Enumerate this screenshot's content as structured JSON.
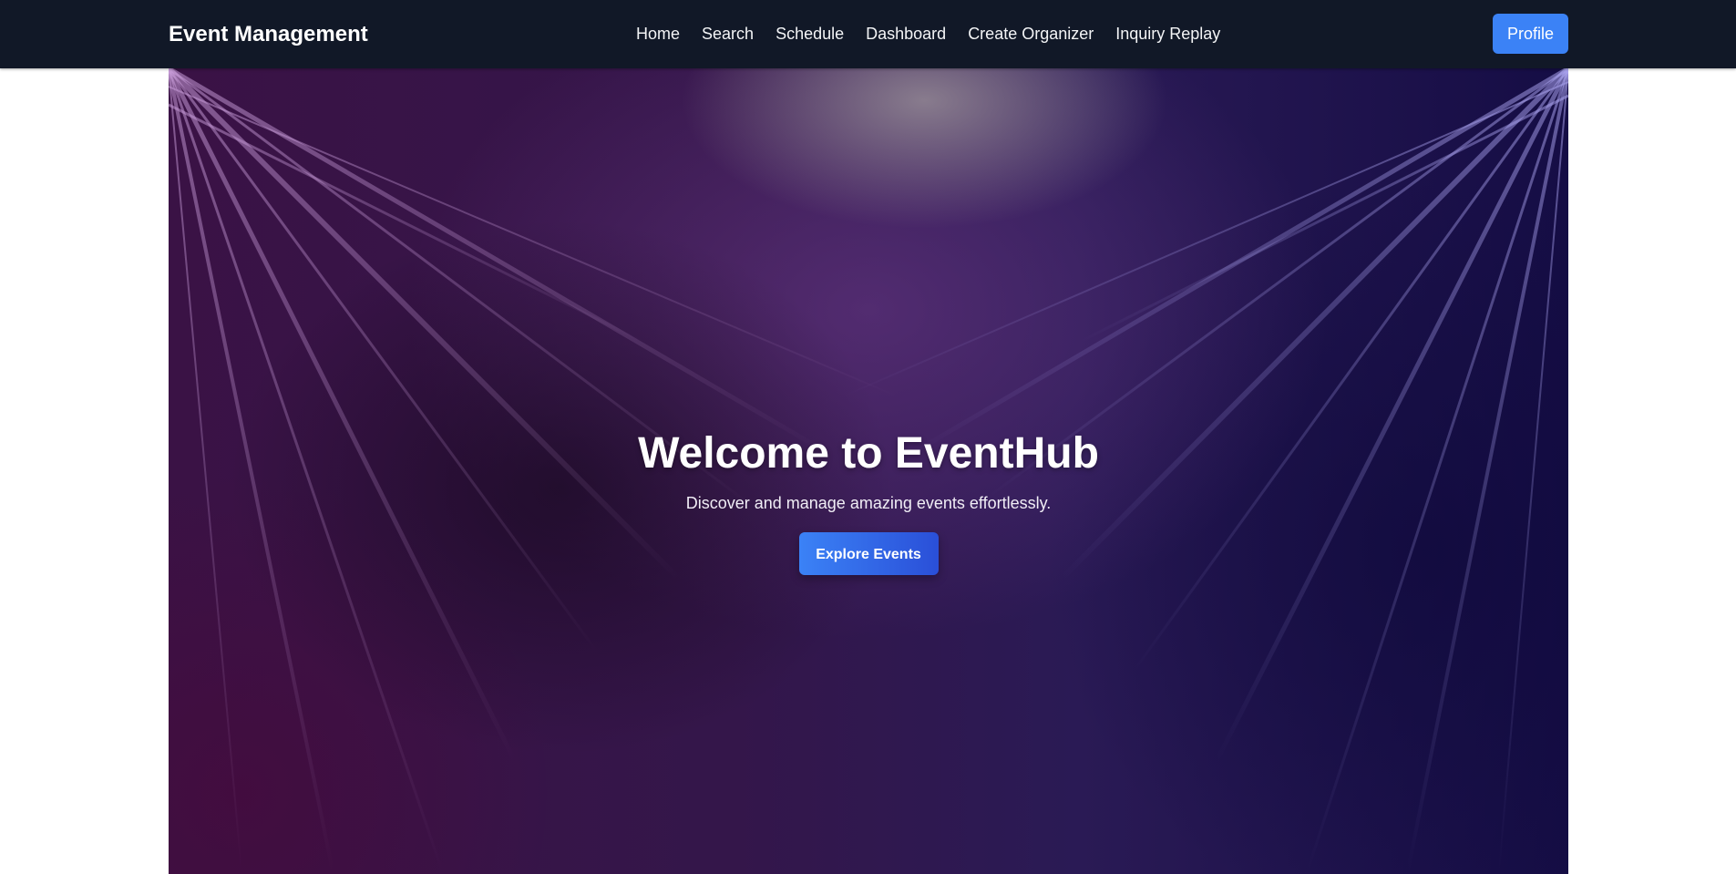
{
  "navbar": {
    "brand": "Event Management",
    "links": [
      {
        "label": "Home"
      },
      {
        "label": "Search"
      },
      {
        "label": "Schedule"
      },
      {
        "label": "Dashboard"
      },
      {
        "label": "Create Organizer"
      },
      {
        "label": "Inquiry Replay"
      }
    ],
    "profile_label": "Profile"
  },
  "hero": {
    "title": "Welcome to EventHub",
    "subtitle": "Discover and manage amazing events effortlessly.",
    "cta_label": "Explore Events"
  },
  "colors": {
    "navbar_bg": "#111827",
    "accent": "#3b82f6",
    "hero_purple": "#3a1245",
    "hero_indigo": "#150d45"
  }
}
